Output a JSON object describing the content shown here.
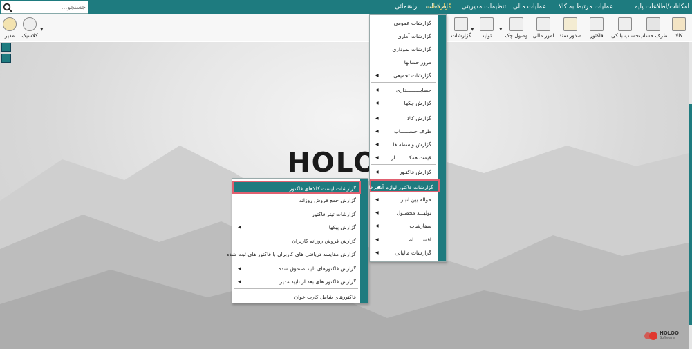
{
  "menubar": {
    "items": [
      "امکانات/اطلاعات پایه",
      "عملیات مرتبط به کالا",
      "عملیات مالی",
      "تنظیمات مدیریتی",
      "اصلاحات",
      "گزارشات",
      "راهنمائی"
    ],
    "active": "گزارشات",
    "search_placeholder": "جستجو..."
  },
  "toolbar": {
    "buttons": [
      "کالا",
      "طرف حساب",
      "حساب بانکی",
      "فاکتور",
      "صدور سند",
      "امور مالی",
      "وصول چک",
      "تولید",
      "گزارشات"
    ],
    "left": [
      "کلاسیک",
      "مدیر"
    ]
  },
  "brand_text": "HOLO",
  "logo": {
    "name": "HOLOO",
    "sub": "Software",
    "fa": "هلو"
  },
  "menu1": {
    "items": [
      "گزارشات عمومی",
      "گزارشات آماری",
      "گزارشات نموداری",
      "مرور حسابها",
      "گزارشات تجمیعی",
      "حسابـــــــــداری",
      "گزارش چکها",
      "گزارش کالا",
      "طرف حســــــاب",
      "گزارش واسطه ها",
      "قیمت همکـــــــــار",
      "گزارش فاکتـور",
      "گزارشات فاکتور لوازم آشپزخانه",
      "حواله بین انبار",
      "تولیـــد محصـول",
      "سفارشات",
      "اقســــــاط",
      "گزارشات مالیاتی"
    ]
  },
  "menu2": {
    "items": [
      "گزارشات لیست کالاهای فاکتور",
      "گزارش جمع فروش روزانه",
      "گزارشات تیتر فاکتور",
      "گزارش پیکها",
      "گزارش فروش روزانه کاربران",
      "گزارش مقایسه دریافتی های  کاربران با فاکتور های ثبت شده",
      "گزارش فاکتورهای تایید صندوق شده",
      "گزارش فاکتور های بعد از تایید مدیر",
      "فاکتورهای شامل کارت خوان"
    ]
  },
  "colors": {
    "accent": "#1e7b7f",
    "active_menu": "#f1d36b",
    "highlight_border": "#e06070"
  }
}
